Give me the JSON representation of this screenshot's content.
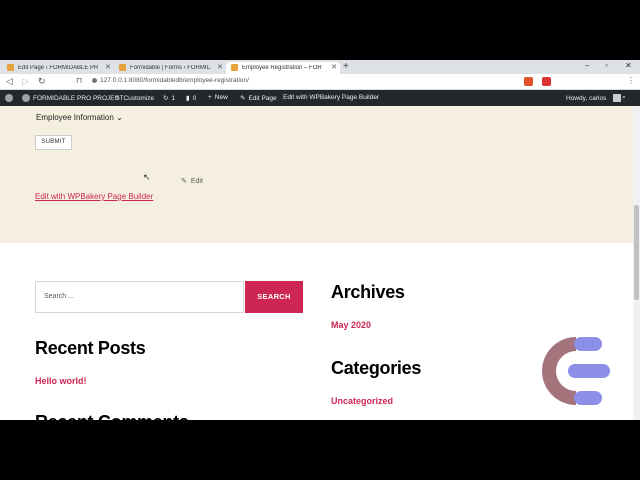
{
  "browser": {
    "tabs": [
      {
        "label": "Edit Page ‹ FORMIDABLE PRO PR..."
      },
      {
        "label": "Formidable | Forms ‹ FORMIDABLE..."
      },
      {
        "label": "Employee Registration – FORMIDA..."
      }
    ],
    "new_tab": "+",
    "window_controls": {
      "minimize": "–",
      "maximize": "▫",
      "close": "✕"
    },
    "url": "127.0.0.1:8080/formidabledb/employee-registration/"
  },
  "adminbar": {
    "site_name": "FORMIDABLE PRO PROJECT",
    "customize": "Customize",
    "updates_count": "1",
    "comments_count": "0",
    "new_label": "New",
    "edit_page": "Edit Page",
    "wpbakery": "Edit with WPBakery Page Builder",
    "greeting": "Howdy, carlos"
  },
  "form": {
    "dropdown_label": "Employee Information",
    "submit_label": "SUBMIT",
    "edit_label": "Edit",
    "wpbakery_link": "Edit with WPBakery Page Builder"
  },
  "search": {
    "placeholder": "Search ...",
    "button": "SEARCH"
  },
  "widgets": {
    "archives_title": "Archives",
    "archives_item": "May 2020",
    "recent_posts_title": "Recent Posts",
    "recent_posts_item": "Hello world!",
    "categories_title": "Categories",
    "categories_item": "Uncategorized",
    "recent_comments_title": "Recent Comments"
  },
  "colors": {
    "accent": "#cd2653",
    "beige": "#f5efe0",
    "adminbar": "#23282d"
  }
}
